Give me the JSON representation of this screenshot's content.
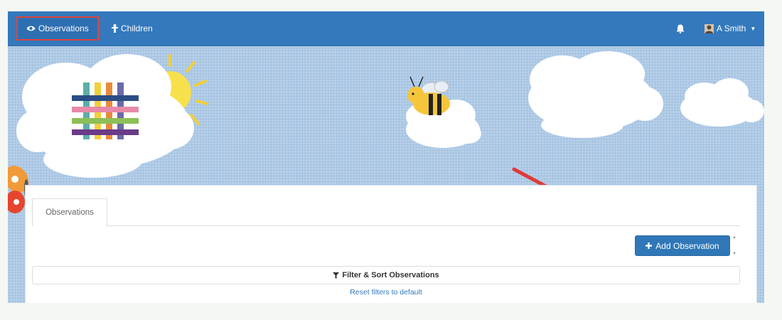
{
  "navbar": {
    "items": [
      {
        "label": "Observations",
        "icon": "eye-icon",
        "active": true
      },
      {
        "label": "Children",
        "icon": "child-icon",
        "active": false
      }
    ],
    "notifications_icon": "bell-icon",
    "user": {
      "label": "A Smith",
      "icon": "user-icon",
      "caret": "caret-down-icon"
    }
  },
  "panel": {
    "tab_label": "Observations",
    "add_button_label": "Add Observation",
    "add_button_icon": "plus-icon",
    "filter_label": "Filter & Sort Observations",
    "filter_icon": "filter-icon",
    "reset_link": "Reset filters to default"
  },
  "colors": {
    "navbar": "#3479bd",
    "highlight": "#e0443b",
    "sky": "#a7c5e3",
    "primary_button": "#3077b8",
    "annotation_arrow": "#e03a36"
  }
}
